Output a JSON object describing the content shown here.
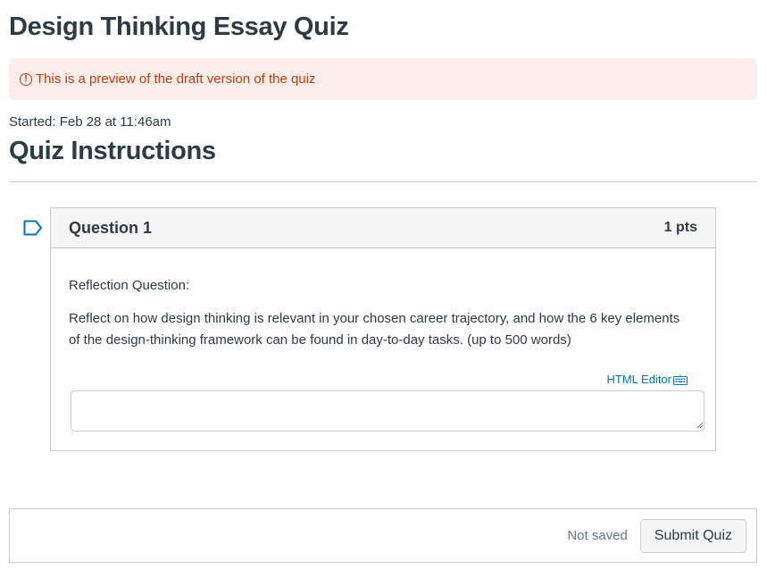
{
  "page": {
    "title": "Design Thinking Essay Quiz"
  },
  "preview_banner": {
    "icon": "warning-circle-icon",
    "text": "This is a preview of the draft version of the quiz",
    "color": "#c23c0d",
    "background": "#fbeeeb"
  },
  "started": "Started: Feb 28 at 11:46am",
  "instructions_heading": "Quiz Instructions",
  "question": {
    "flag_icon": "bookmark-flag-icon",
    "name": "Question 1",
    "points": "1 pts",
    "label": "Reflection Question:",
    "text": "Reflect on how design thinking is relevant in your chosen career trajectory, and how the 6 key elements of the design-thinking framework can be found in day-to-day tasks. (up to 500 words)",
    "editor_link": "HTML Editor",
    "editor_icon": "keyboard-icon",
    "answer_value": ""
  },
  "footer": {
    "status": "Not saved",
    "submit_label": "Submit Quiz"
  },
  "colors": {
    "text": "#2d3b45",
    "link": "#0374b5",
    "border": "#c7cdd1"
  }
}
